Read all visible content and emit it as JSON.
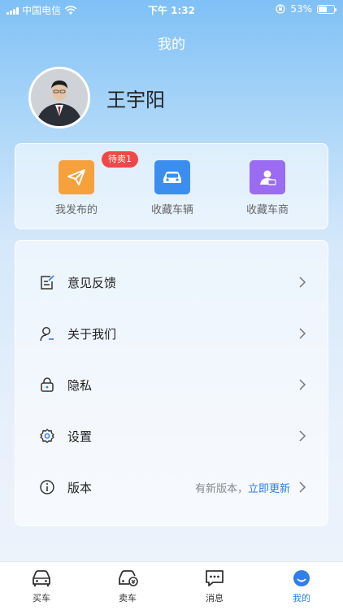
{
  "status_bar": {
    "carrier": "中国电信",
    "time": "下午 1:32",
    "battery": "53%",
    "battery_level": 0.53
  },
  "page": {
    "title": "我的"
  },
  "profile": {
    "name": "王宇阳"
  },
  "shortcuts": [
    {
      "label": "我发布的",
      "badge": "待卖1",
      "icon": "paper-plane-icon",
      "color": "#f6a13c"
    },
    {
      "label": "收藏车辆",
      "icon": "car-icon",
      "color": "#3b8ef0"
    },
    {
      "label": "收藏车商",
      "icon": "dealer-person-icon",
      "color": "#9b6bf2"
    }
  ],
  "menu": [
    {
      "label": "意见反馈",
      "icon": "feedback-icon"
    },
    {
      "label": "关于我们",
      "icon": "about-person-icon"
    },
    {
      "label": "隐私",
      "icon": "lock-icon"
    },
    {
      "label": "设置",
      "icon": "gear-icon"
    },
    {
      "label": "版本",
      "icon": "info-icon",
      "extra_text": "有新版本，",
      "extra_link": "立即更新"
    }
  ],
  "tabs": [
    {
      "label": "买车",
      "icon": "car-front-icon"
    },
    {
      "label": "卖车",
      "icon": "car-sell-icon"
    },
    {
      "label": "消息",
      "icon": "message-icon"
    },
    {
      "label": "我的",
      "icon": "profile-icon",
      "active": true
    }
  ],
  "colors": {
    "accent": "#2f7fe6",
    "badge": "#f04848"
  }
}
